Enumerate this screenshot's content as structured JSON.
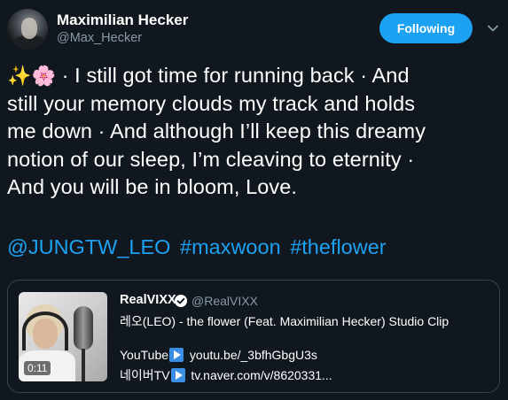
{
  "author": {
    "display_name": "Maximilian Hecker",
    "handle": "@Max_Hecker",
    "follow_label": "Following"
  },
  "tweet": {
    "emojis": "✨🌸",
    "line1": " · I still got time for running back · And",
    "line2": "still your memory clouds my track and holds",
    "line3": "me down · And although I’ll keep this dreamy",
    "line4": "notion of our sleep, I’m cleaving to eternity ·",
    "line5": "And you will be in bloom, Love.",
    "mention": "@JUNGTW_LEO",
    "hashtags": [
      "#maxwoon",
      "#theflower"
    ]
  },
  "quoted": {
    "name": "RealVIXX",
    "handle": "@RealVIXX",
    "title": "레오(LEO) - the flower (Feat. Maximilian Hecker) Studio Clip",
    "youtube_label": "YouTube",
    "youtube_link": "youtu.be/_3bfhGbgU3s",
    "naver_label": "네이버TV",
    "naver_link": "tv.naver.com/v/8620331...",
    "video_duration": "0:11"
  },
  "colors": {
    "background": "#10171e",
    "accent": "#1da1f2",
    "muted": "#8899a6",
    "border": "#38444d"
  },
  "icons": [
    "chevron-down-icon",
    "verified-badge-icon",
    "play-button-icon"
  ]
}
